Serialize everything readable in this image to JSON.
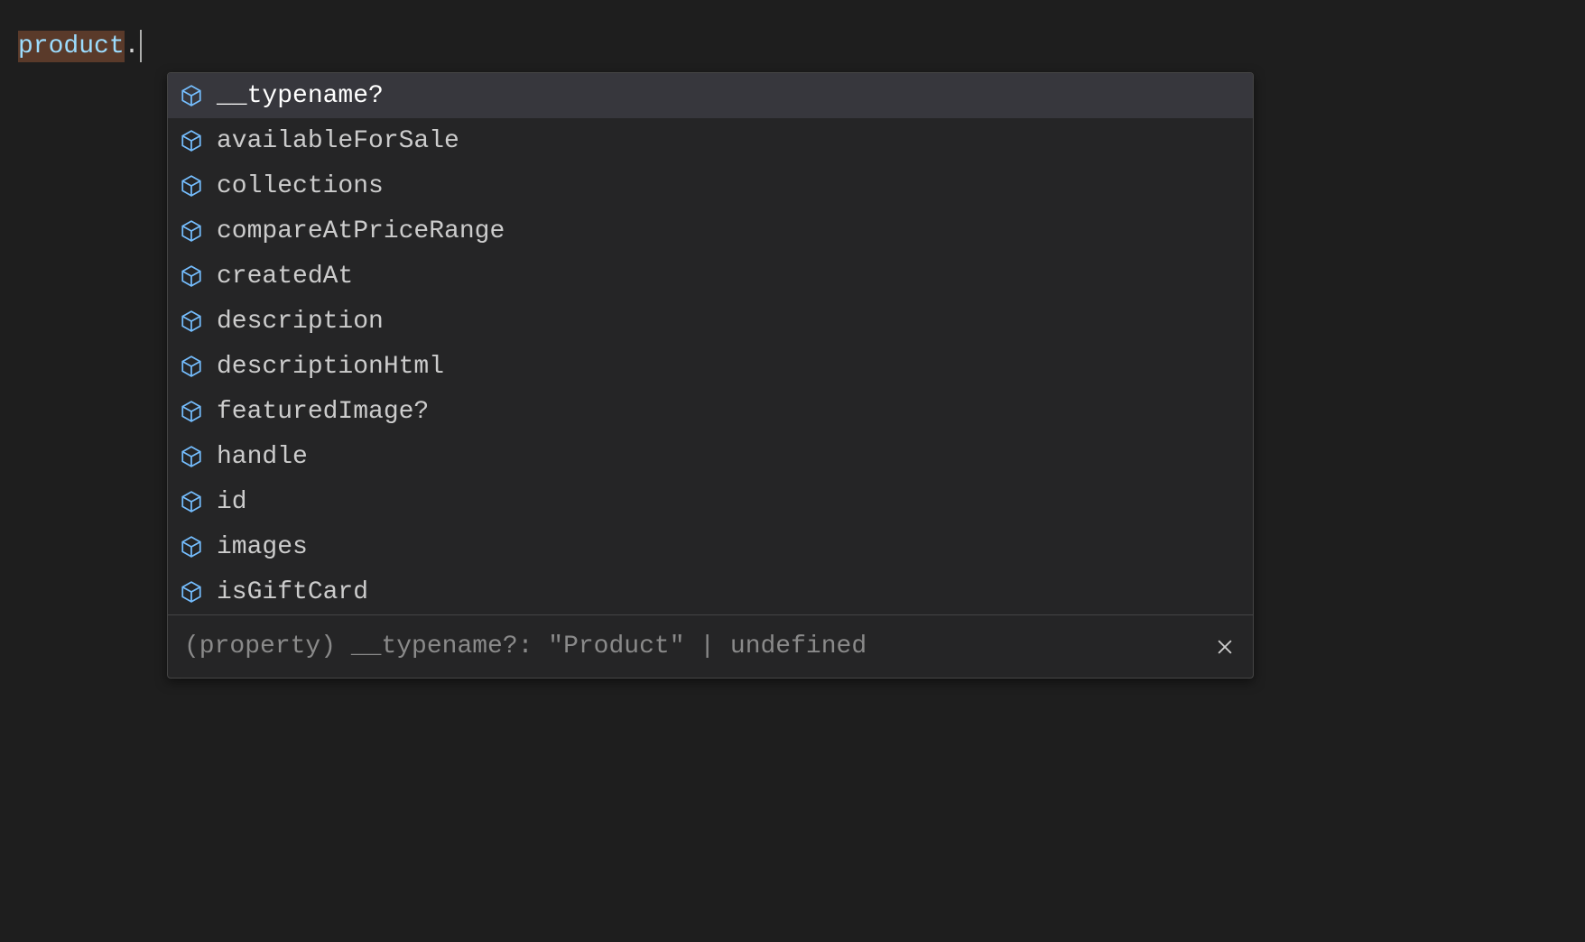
{
  "editor": {
    "token": "product",
    "after_token": "."
  },
  "suggest": {
    "items": [
      {
        "label": "__typename?",
        "selected": true
      },
      {
        "label": "availableForSale",
        "selected": false
      },
      {
        "label": "collections",
        "selected": false
      },
      {
        "label": "compareAtPriceRange",
        "selected": false
      },
      {
        "label": "createdAt",
        "selected": false
      },
      {
        "label": "description",
        "selected": false
      },
      {
        "label": "descriptionHtml",
        "selected": false
      },
      {
        "label": "featuredImage?",
        "selected": false
      },
      {
        "label": "handle",
        "selected": false
      },
      {
        "label": "id",
        "selected": false
      },
      {
        "label": "images",
        "selected": false
      },
      {
        "label": "isGiftCard",
        "selected": false
      }
    ],
    "details": "(property) __typename?: \"Product\" | undefined"
  }
}
